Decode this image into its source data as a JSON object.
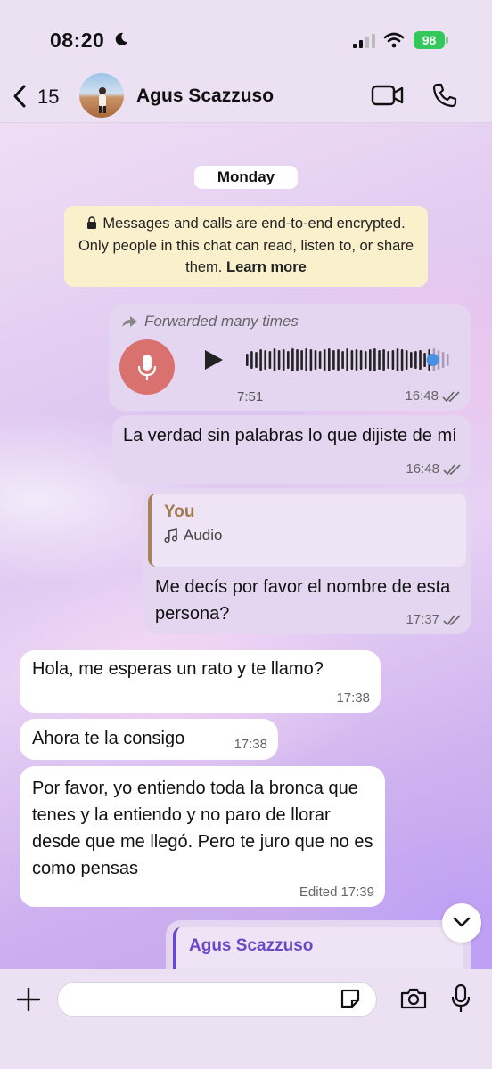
{
  "status_bar": {
    "time": "08:20",
    "battery": "98"
  },
  "header": {
    "back_count": "15",
    "contact_name": "Agus Scazzuso"
  },
  "chat": {
    "day_label": "Monday",
    "encryption": {
      "text": "Messages and calls are end-to-end encrypted. Only people in this chat can read, listen to, or share them.",
      "link": "Learn more"
    },
    "messages": [
      {
        "type": "voice",
        "direction": "out",
        "forwarded_label": "Forwarded many times",
        "duration": "7:51",
        "time": "16:48",
        "progress": 0.9
      },
      {
        "type": "text",
        "direction": "out",
        "text": "La verdad sin palabras lo que dijiste de mí",
        "time": "16:48"
      },
      {
        "type": "reply",
        "direction": "out",
        "quote_author": "You",
        "quote_text": "Audio",
        "text": "Me decís por favor el nombre de esta persona?",
        "time": "17:37"
      },
      {
        "type": "text",
        "direction": "in",
        "text": "Hola, me esperas un rato y te llamo?",
        "time": "17:38"
      },
      {
        "type": "text",
        "direction": "in",
        "text": "Ahora te la consigo",
        "time": "17:38"
      },
      {
        "type": "text",
        "direction": "in",
        "text": "Por favor, yo entiendo toda la bronca que tenes y la entiendo y no paro de llorar desde que me llegó. Pero te juro que no es como pensas",
        "edited_label": "Edited",
        "time": "17:39"
      },
      {
        "type": "reply",
        "direction": "out",
        "quote_author": "Agus Scazzuso"
      }
    ]
  },
  "composer": {
    "input_value": ""
  },
  "colors": {
    "accent_green": "#34c759",
    "voice_progress": "#4a90e2",
    "mic_avatar": "#d9726e"
  }
}
